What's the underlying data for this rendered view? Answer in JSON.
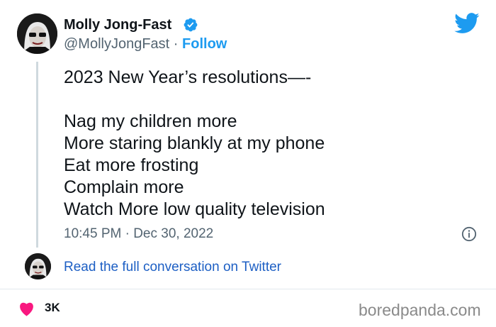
{
  "tweet": {
    "display_name": "Molly Jong-Fast",
    "handle": "@MollyJongFast",
    "separator": " · ",
    "follow_label": "Follow",
    "text": "2023 New Year’s resolutions—-\n\nNag my children more\nMore staring blankly at my phone\nEat more frosting\nComplain more\nWatch More low quality television",
    "timestamp": "10:45 PM · Dec 30, 2022",
    "read_link": "Read the full conversation on Twitter",
    "like_count": "3K"
  },
  "watermark": "boredpanda.com",
  "colors": {
    "twitter_blue": "#1d9bf0",
    "heart_pink": "#f91880",
    "link_blue": "#1d5fc4"
  },
  "icons": [
    "verified-badge-icon",
    "twitter-bird-icon",
    "info-icon",
    "heart-icon"
  ]
}
